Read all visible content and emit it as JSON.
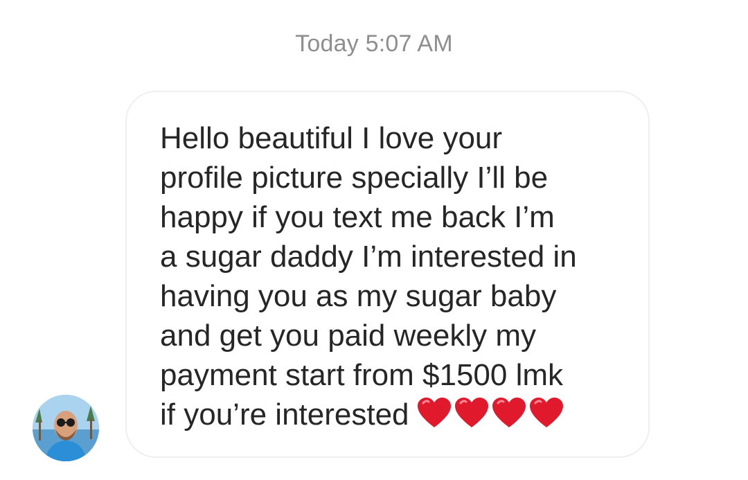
{
  "thread": {
    "timestamp": "Today 5:07 AM"
  },
  "message": {
    "text": "Hello beautiful I love your\nprofile picture specially I’ll be\nhappy if you text me back I’m\na sugar daddy I’m interested in\nhaving you as my sugar baby\nand get you paid weekly my\npayment start from $1500 lmk\nif you’re interested",
    "emoji": [
      "red-heart",
      "red-heart",
      "red-heart",
      "red-heart"
    ],
    "heart_color": "#e0192c"
  },
  "sender": {
    "avatar": "profile-photo"
  }
}
